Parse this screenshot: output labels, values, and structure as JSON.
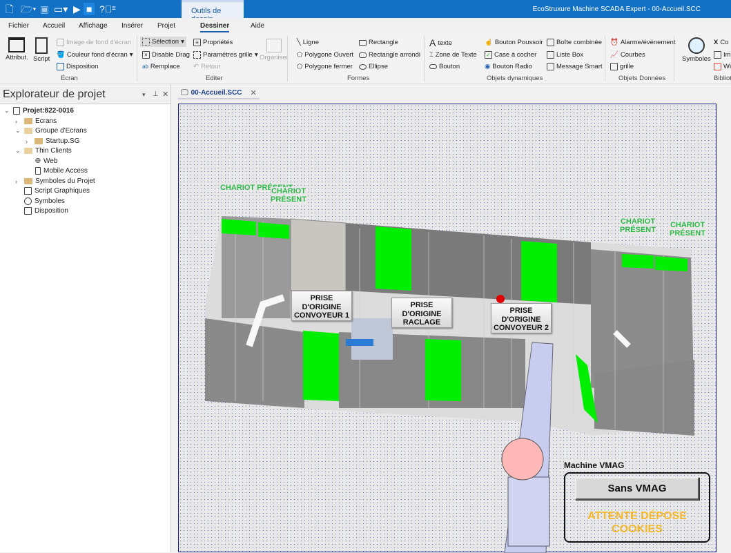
{
  "titlebar": {
    "app_title": "EcoStruxure Machine SCADA Expert - 00-Accueil.SCC",
    "context_tab": "Outils de dessin",
    "quick_access": [
      "new-file-icon",
      "open-folder-icon",
      "save-icon",
      "window-icon",
      "run-icon",
      "stop-icon",
      "help-icon",
      "customize-icon"
    ]
  },
  "menu": {
    "tabs": [
      "Fichier",
      "Accueil",
      "Affichage",
      "Insérer",
      "Projet",
      "Dessiner",
      "Aide"
    ],
    "active": "Dessiner"
  },
  "ribbon": {
    "ecran": {
      "label": "Écran",
      "attribut": "Attribut.",
      "script": "Script",
      "image_fond": "Image de fond d'écran",
      "couleur_fond": "Couleur fond d'écran",
      "disposition": "Disposition"
    },
    "editer": {
      "label": "Editer",
      "selection": "Sélection",
      "disable_drag": "Disable Drag",
      "remplace": "Remplace",
      "proprietes": "Propriétés",
      "parametres_grille": "Paramètres grille",
      "retour": "Retour",
      "organiser": "Organiser"
    },
    "formes": {
      "label": "Formes",
      "ligne": "Ligne",
      "polygone_ouvert": "Polygone Ouvert",
      "polygone_fermer": "Polygone fermer",
      "rectangle": "Rectangle",
      "rectangle_arrondi": "Rectangle arrondi",
      "ellipse": "Ellipse"
    },
    "objets_dynamiques": {
      "label": "Objets dynamiques",
      "texte": "texte",
      "zone_texte": "Zone de Texte",
      "bouton": "Bouton",
      "bouton_poussoir": "Bouton Poussoir",
      "case_cocher": "Case à cocher",
      "bouton_radio": "Bouton Radio",
      "boite_combinee": "Boîte combinée",
      "liste_box": "Liste Box",
      "message_smart": "Message Smart"
    },
    "objets_donnees": {
      "label": "Objets Données",
      "alarme": "Alarme/événement",
      "courbes": "Courbes",
      "grille": "grille"
    },
    "bibliotheque": {
      "label": "Bibliot",
      "symboles": "Symboles",
      "items": [
        "Co",
        "Ima",
        "Wi"
      ]
    }
  },
  "explorer": {
    "title": "Explorateur de projet",
    "tree": [
      {
        "label": "Projet:822-0016",
        "level": 0,
        "expanded": true,
        "icon": "project-icon"
      },
      {
        "label": "Ecrans",
        "level": 1,
        "expanded": false,
        "icon": "folder-icon"
      },
      {
        "label": "Groupe d'Ecrans",
        "level": 1,
        "expanded": true,
        "icon": "folder-open-icon"
      },
      {
        "label": "Startup.SG",
        "level": 2,
        "expanded": false,
        "icon": "folder-icon"
      },
      {
        "label": "Thin Clients",
        "level": 1,
        "expanded": true,
        "icon": "folder-open-icon"
      },
      {
        "label": "Web",
        "level": 2,
        "icon": "globe-icon"
      },
      {
        "label": "Mobile Access",
        "level": 2,
        "icon": "mobile-icon"
      },
      {
        "label": "Symboles du Projet",
        "level": 1,
        "expanded": false,
        "icon": "folder-icon"
      },
      {
        "label": "Script Graphiques",
        "level": 1,
        "icon": "script-icon"
      },
      {
        "label": "Symboles",
        "level": 1,
        "icon": "gauge-icon"
      },
      {
        "label": "Disposition",
        "level": 1,
        "icon": "layout-icon"
      }
    ]
  },
  "document": {
    "tab": "00-Accueil.SCC",
    "chariots": [
      "CHARIOT PRÉSENT",
      "CHARIOT PRÉSENT",
      "CHARIOT PRÉSENT",
      "CHARIOT PRÉSENT"
    ],
    "buttons": [
      "PRISE D'ORIGINE CONVOYEUR 1",
      "PRISE D'ORIGINE RACLAGE",
      "PRISE D'ORIGINE CONVOYEUR 2"
    ],
    "vmag": {
      "label": "Machine VMAG",
      "button": "Sans VMAG",
      "status": "ATTENTE DÉPOSE COOKIES"
    },
    "colors": {
      "present": "#00ee00",
      "chariot_text": "#2fb84a",
      "status": "#f5b82a",
      "alarm": "#e00000"
    }
  }
}
